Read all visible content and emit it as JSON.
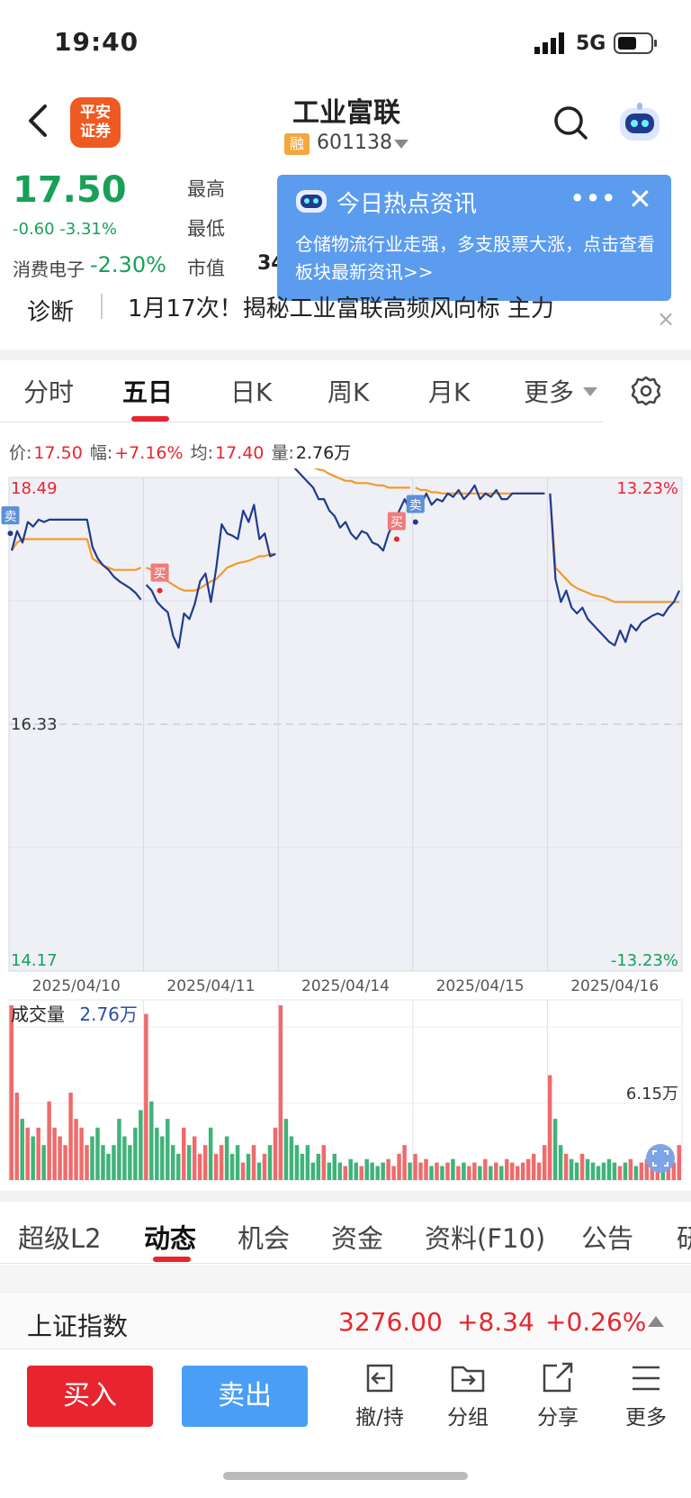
{
  "status_bar": {
    "time": "19:40",
    "network": "5G"
  },
  "header": {
    "broker_logo": "平安\n证券",
    "broker_logo_line1": "平安",
    "broker_logo_line2": "证券",
    "title": "工业富联",
    "margin_badge": "融",
    "code": "601138"
  },
  "quote": {
    "price": "17.50",
    "change": "-0.60 -3.31%",
    "sector_name": "消费电子",
    "sector_change": "-2.30%",
    "label_high": "最高",
    "label_low": "最低",
    "label_cap": "市值",
    "cap_partial": "34"
  },
  "popup": {
    "title": "今日热点资讯",
    "more": "•••",
    "close": "✕",
    "body": "仓储物流行业走强，多支股票大涨，点击查看板块最新资讯>>"
  },
  "diagnosis": {
    "label": "诊断",
    "text": "1月17次！揭秘工业富联高频风向标 主力",
    "close": "×"
  },
  "chart_tabs": [
    "分时",
    "五日",
    "日K",
    "周K",
    "月K",
    "更多"
  ],
  "info": {
    "price_label": "价:",
    "price": "17.50",
    "amp_label": "幅:",
    "amp": "+7.16%",
    "avg_label": "均:",
    "avg": "17.40",
    "vol_label": "量:",
    "vol": "2.76万"
  },
  "chart_data": {
    "type": "line",
    "y_ticks": [
      "18.49",
      "16.33",
      "14.17"
    ],
    "pct_ticks": [
      "13.23%",
      "-13.23%"
    ],
    "ylim": [
      14.17,
      18.49
    ],
    "x_dates": [
      "2025/04/10",
      "2025/04/11",
      "2025/04/14",
      "2025/04/15",
      "2025/04/16"
    ],
    "series": [
      {
        "name": "price",
        "values": [
          17.85,
          18.02,
          17.92,
          18.1,
          18.06,
          18.12,
          18.1,
          18.12,
          18.12,
          18.12,
          18.12,
          18.12,
          18.12,
          18.12,
          18.12,
          17.88,
          17.78,
          17.72,
          17.68,
          17.62,
          17.58,
          17.55,
          17.52,
          17.48,
          17.42,
          17.55,
          17.5,
          17.4,
          17.35,
          17.31,
          17.1,
          17.0,
          17.3,
          17.25,
          17.38,
          17.58,
          17.65,
          17.4,
          17.7,
          18.08,
          18.0,
          17.98,
          17.95,
          18.2,
          18.1,
          18.25,
          17.95,
          18.0,
          17.8,
          17.82,
          18.98,
          18.8,
          18.6,
          18.55,
          18.5,
          18.45,
          18.4,
          18.3,
          18.3,
          18.2,
          18.15,
          18.05,
          18.1,
          18.0,
          17.95,
          18.02,
          18.0,
          17.92,
          17.9,
          17.85,
          18.0,
          18.1,
          18.2,
          18.3,
          18.2,
          18.2,
          18.25,
          18.35,
          18.25,
          18.3,
          18.28,
          18.35,
          18.32,
          18.38,
          18.3,
          18.35,
          18.42,
          18.3,
          18.35,
          18.32,
          18.38,
          18.3,
          18.3,
          18.35,
          18.35,
          18.35,
          18.35,
          18.35,
          18.35,
          18.35,
          18.35,
          17.6,
          17.4,
          17.5,
          17.35,
          17.3,
          17.35,
          17.25,
          17.2,
          17.15,
          17.1,
          17.05,
          17.02,
          17.15,
          17.05,
          17.2,
          17.15,
          17.22,
          17.25,
          17.28,
          17.3,
          17.28,
          17.35,
          17.4,
          17.5
        ]
      },
      {
        "name": "avg",
        "values": [
          17.85,
          17.92,
          17.95,
          17.95,
          17.95,
          17.95,
          17.95,
          17.95,
          17.95,
          17.95,
          17.95,
          17.95,
          17.95,
          17.95,
          17.95,
          17.78,
          17.75,
          17.72,
          17.7,
          17.68,
          17.68,
          17.68,
          17.68,
          17.68,
          17.7,
          17.7,
          17.68,
          17.65,
          17.6,
          17.58,
          17.55,
          17.52,
          17.5,
          17.5,
          17.5,
          17.52,
          17.55,
          17.58,
          17.6,
          17.65,
          17.7,
          17.72,
          17.74,
          17.75,
          17.76,
          17.78,
          17.8,
          17.8,
          17.82,
          17.82,
          18.9,
          18.75,
          18.7,
          18.65,
          18.62,
          18.6,
          18.58,
          18.56,
          18.55,
          18.52,
          18.5,
          18.48,
          18.46,
          18.46,
          18.44,
          18.44,
          18.44,
          18.43,
          18.42,
          18.42,
          18.4,
          18.4,
          18.4,
          18.4,
          18.4,
          18.4,
          18.38,
          18.38,
          18.36,
          18.36,
          18.35,
          18.35,
          18.35,
          18.35,
          18.35,
          18.35,
          18.35,
          18.35,
          18.35,
          18.35,
          18.35,
          18.35,
          18.35,
          18.35,
          18.35,
          18.35,
          18.35,
          18.35,
          18.35,
          18.35,
          18.35,
          17.7,
          17.65,
          17.6,
          17.55,
          17.52,
          17.5,
          17.48,
          17.46,
          17.45,
          17.44,
          17.42,
          17.4,
          17.4,
          17.4,
          17.4,
          17.4,
          17.4,
          17.4,
          17.4,
          17.4,
          17.4,
          17.4,
          17.4,
          17.4
        ]
      }
    ],
    "markers": [
      {
        "label": "卖",
        "kind": "sell",
        "day": 0,
        "x": 0.01,
        "y": 18.0
      },
      {
        "label": "买",
        "kind": "buy",
        "day": 1,
        "x": 0.12,
        "y": 17.5
      },
      {
        "label": "卖",
        "kind": "sell",
        "day": 2,
        "x": 0.3,
        "y": 18.85
      },
      {
        "label": "买",
        "kind": "buy",
        "day": 2,
        "x": 0.88,
        "y": 17.95
      },
      {
        "label": "卖",
        "kind": "sell",
        "day": 3,
        "x": 0.02,
        "y": 18.1
      }
    ]
  },
  "volume": {
    "label": "成交量",
    "value": "2.76万",
    "max_label": "6.15万",
    "bars": [
      1.0,
      0.5,
      0.35,
      0.3,
      0.25,
      0.3,
      0.2,
      0.45,
      0.3,
      0.25,
      0.2,
      0.5,
      0.35,
      0.3,
      0.2,
      0.25,
      0.3,
      0.2,
      0.15,
      0.2,
      0.35,
      0.25,
      0.2,
      0.3,
      0.4,
      0.95,
      0.45,
      0.3,
      0.25,
      0.35,
      0.2,
      0.15,
      0.3,
      0.2,
      0.25,
      0.15,
      0.2,
      0.3,
      0.15,
      0.2,
      0.25,
      0.15,
      0.2,
      0.1,
      0.15,
      0.2,
      0.1,
      0.15,
      0.2,
      0.3,
      1.0,
      0.35,
      0.25,
      0.2,
      0.15,
      0.2,
      0.1,
      0.15,
      0.2,
      0.1,
      0.15,
      0.1,
      0.08,
      0.12,
      0.1,
      0.08,
      0.12,
      0.1,
      0.08,
      0.1,
      0.12,
      0.08,
      0.15,
      0.2,
      0.1,
      0.15,
      0.1,
      0.12,
      0.08,
      0.1,
      0.08,
      0.1,
      0.12,
      0.08,
      0.1,
      0.08,
      0.1,
      0.08,
      0.12,
      0.08,
      0.1,
      0.08,
      0.12,
      0.1,
      0.08,
      0.1,
      0.12,
      0.15,
      0.1,
      0.2,
      0.6,
      0.35,
      0.2,
      0.15,
      0.12,
      0.1,
      0.15,
      0.12,
      0.1,
      0.08,
      0.1,
      0.12,
      0.1,
      0.08,
      0.1,
      0.12,
      0.08,
      0.1,
      0.12,
      0.08,
      0.1,
      0.12,
      0.15,
      0.1,
      0.2
    ]
  },
  "bottom_tabs": [
    "超级L2",
    "动态",
    "机会",
    "资金",
    "资料(F10)",
    "公告",
    "研"
  ],
  "index": {
    "name": "上证指数",
    "value": "3276.00",
    "change": "+8.34",
    "pct": "+0.26%"
  },
  "actions": {
    "buy": "买入",
    "sell": "卖出",
    "cancel": "撤/持",
    "group": "分组",
    "share": "分享",
    "more": "更多"
  },
  "colors": {
    "up": "#e8252e",
    "down": "#18a058",
    "price_line": "#1f3b8f",
    "avg_line": "#f39a2b",
    "accent_blue": "#4a9ef5"
  }
}
